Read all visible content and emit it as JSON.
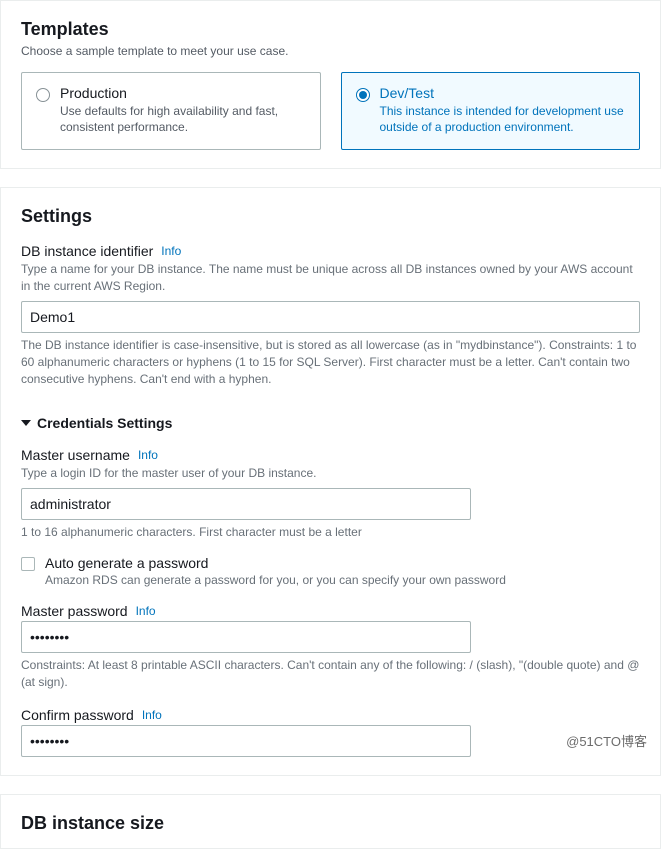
{
  "templates": {
    "title": "Templates",
    "subtitle": "Choose a sample template to meet your use case.",
    "options": [
      {
        "label": "Production",
        "description": "Use defaults for high availability and fast, consistent performance.",
        "selected": false
      },
      {
        "label": "Dev/Test",
        "description_prefix": "This instance is intended for development use outside of ",
        "description_link": "a production environment.",
        "selected": true
      }
    ]
  },
  "settings": {
    "title": "Settings",
    "db_identifier": {
      "label": "DB instance identifier",
      "info": "Info",
      "hint": "Type a name for your DB instance. The name must be unique across all DB instances owned by your AWS account in the current AWS Region.",
      "value": "Demo1",
      "constraint": "The DB instance identifier is case-insensitive, but is stored as all lowercase (as in \"mydbinstance\"). Constraints: 1 to 60 alphanumeric characters or hyphens (1 to 15 for SQL Server). First character must be a letter. Can't contain two consecutive hyphens. Can't end with a hyphen."
    },
    "credentials": {
      "heading": "Credentials Settings",
      "master_username": {
        "label": "Master username",
        "info": "Info",
        "hint": "Type a login ID for the master user of your DB instance.",
        "value": "administrator",
        "constraint": "1 to 16 alphanumeric characters. First character must be a letter"
      },
      "auto_generate": {
        "label": "Auto generate a password",
        "description": "Amazon RDS can generate a password for you, or you can specify your own password",
        "checked": false
      },
      "master_password": {
        "label": "Master password",
        "info": "Info",
        "value": "••••••••",
        "constraint": "Constraints: At least 8 printable ASCII characters. Can't contain any of the following: / (slash), \"(double quote) and @ (at sign)."
      },
      "confirm_password": {
        "label": "Confirm password",
        "info": "Info",
        "value": "••••••••"
      }
    }
  },
  "db_instance_size": {
    "title": "DB instance size"
  },
  "watermark": "@51CTO博客"
}
